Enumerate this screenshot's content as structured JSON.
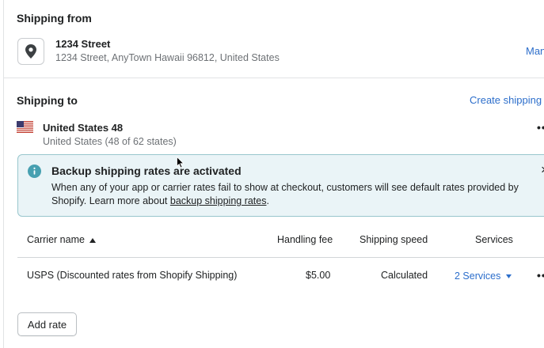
{
  "shipping_from": {
    "title": "Shipping from",
    "location_name": "1234 Street",
    "location_address": "1234 Street, AnyTown Hawaii 96812, United States",
    "manage_link": "Man"
  },
  "shipping_to": {
    "title": "Shipping to",
    "create_zone_link": "Create shipping z",
    "zone_name": "United States 48",
    "zone_detail": "United States (48 of 62 states)",
    "more_actions": "••"
  },
  "banner": {
    "title": "Backup shipping rates are activated",
    "text_before": "When any of your app or carrier rates fail to show at checkout, customers will see default rates provided by Shopify. Learn more about ",
    "link_text": "backup shipping rates",
    "text_after": ".",
    "close_glyph": "×"
  },
  "table": {
    "headers": {
      "carrier": "Carrier name",
      "handling": "Handling fee",
      "speed": "Shipping speed",
      "services": "Services"
    },
    "rows": [
      {
        "carrier": "USPS (Discounted rates from Shopify Shipping)",
        "handling": "$5.00",
        "speed": "Calculated",
        "services": "2 Services",
        "more": "••"
      }
    ]
  },
  "add_rate_label": "Add rate",
  "colors": {
    "link": "#2c6ecb",
    "banner_bg": "#eaf4f7",
    "banner_border": "#98c6cd",
    "info_icon": "#47a0b1"
  }
}
